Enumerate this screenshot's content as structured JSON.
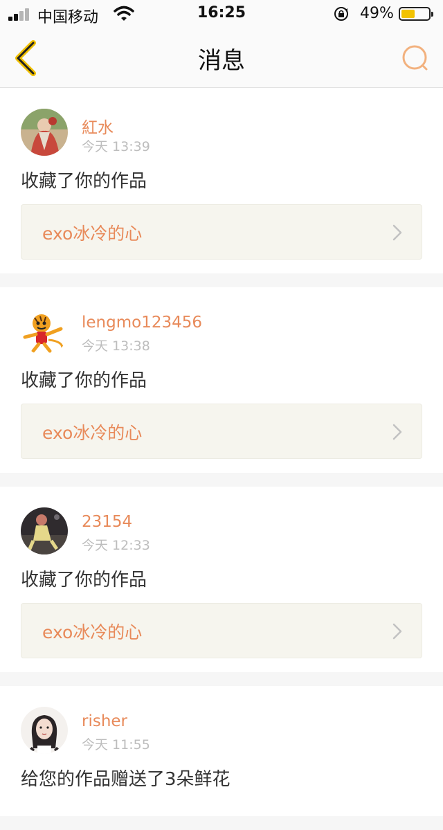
{
  "status_bar": {
    "carrier": "中国移动",
    "time": "16:25",
    "battery_percent": "49%",
    "battery_level": 0.49
  },
  "nav": {
    "title": "消息",
    "back_icon": "chevron-left-icon",
    "search_icon": "search-icon"
  },
  "colors": {
    "accent": "#e88a5a",
    "work_box_bg": "#f6f5ee",
    "timestamp": "#bdbdbd"
  },
  "messages": [
    {
      "username": "紅水",
      "time": "今天 13:39",
      "action": "收藏了你的作品",
      "work_title": "exo冰冷的心"
    },
    {
      "username": "lengmo123456",
      "time": "今天 13:38",
      "action": "收藏了你的作品",
      "work_title": "exo冰冷的心"
    },
    {
      "username": "23154",
      "time": "今天 12:33",
      "action": "收藏了你的作品",
      "work_title": "exo冰冷的心"
    },
    {
      "username": "risher",
      "time": "今天 11:55",
      "action": "给您的作品赠送了3朵鲜花"
    }
  ]
}
